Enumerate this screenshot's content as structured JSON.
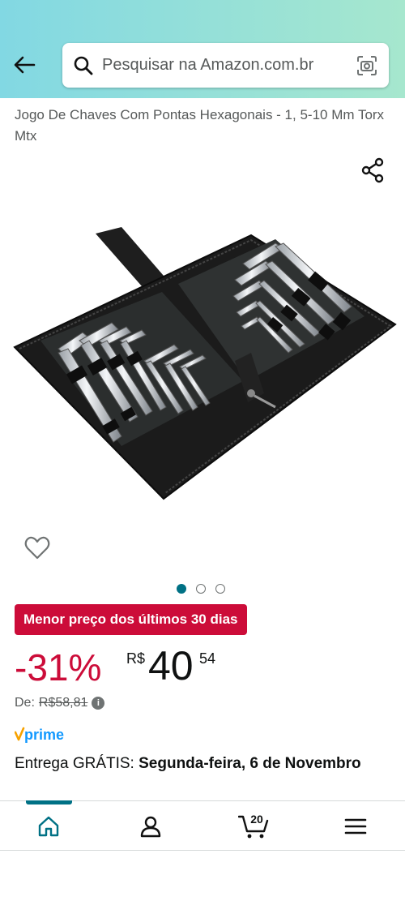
{
  "search": {
    "placeholder": "Pesquisar na Amazon.com.br"
  },
  "product": {
    "title": "Jogo De Chaves Com Pontas Hexagonais - 1, 5-10 Mm Torx Mtx",
    "image_count": 3,
    "current_image_index": 0
  },
  "deal": {
    "badge": "Menor preço dos últimos 30 dias"
  },
  "price": {
    "discount": "-31%",
    "currency": "R$",
    "whole": "40",
    "cents": "54",
    "list_label": "De:",
    "list_price": "R$58,81"
  },
  "prime": {
    "label": "prime"
  },
  "delivery": {
    "prefix": "Entrega GRÁTIS:",
    "date": "Segunda-feira, 6 de Novembro"
  },
  "nav": {
    "cart_count": "20",
    "items": [
      "home-icon",
      "account-icon",
      "cart-icon",
      "menu-icon"
    ]
  },
  "colors": {
    "accent": "#007185",
    "deal_red": "#cc0c39",
    "header_gradient_start": "#82d8e3",
    "header_gradient_end": "#a6e7ce",
    "prime_blue": "#1399ff"
  }
}
